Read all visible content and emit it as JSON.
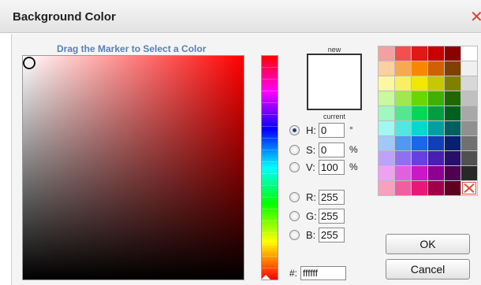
{
  "dialog": {
    "title": "Background Color",
    "close_symbol": "✕"
  },
  "picker": {
    "drag_hint": "Drag the Marker to Select a Color",
    "current_color": "#ffffff",
    "hue_color": "#ff0000"
  },
  "preview": {
    "new_label": "new",
    "current_label": "current",
    "new_color": "#ffffff"
  },
  "fields": {
    "h": {
      "label": "H:",
      "value": "0",
      "unit": "°",
      "selected": true
    },
    "s": {
      "label": "S:",
      "value": "0",
      "unit": "%"
    },
    "v": {
      "label": "V:",
      "value": "100",
      "unit": "%"
    },
    "r": {
      "label": "R:",
      "value": "255"
    },
    "g": {
      "label": "G:",
      "value": "255"
    },
    "b": {
      "label": "B:",
      "value": "255"
    },
    "hex": {
      "label": "#:",
      "value": "ffffff"
    }
  },
  "palette": [
    "#f4a0a0",
    "#f25050",
    "#e01818",
    "#c80000",
    "#8c0000",
    "#ffffff",
    "#fcd0a0",
    "#f8a850",
    "#f88800",
    "#d06000",
    "#804000",
    "#f0f0f0",
    "#fcf8a0",
    "#f8f060",
    "#f0e800",
    "#c8c800",
    "#808000",
    "#d8d8d8",
    "#c8f8a0",
    "#a0e850",
    "#68d800",
    "#40b000",
    "#206800",
    "#c0c0c0",
    "#a0f8c0",
    "#50e890",
    "#00d858",
    "#00a040",
    "#006020",
    "#a8a8a8",
    "#a0f8f0",
    "#50e8e0",
    "#00d8d0",
    "#00a0a0",
    "#006060",
    "#909090",
    "#a0c8f8",
    "#5098f0",
    "#1868e8",
    "#1040b8",
    "#082070",
    "#707070",
    "#c0a0f8",
    "#9070f0",
    "#6840e0",
    "#4820b0",
    "#281068",
    "#505050",
    "#f0a0f0",
    "#e060e0",
    "#c818c8",
    "#900090",
    "#500050",
    "#282828",
    "#f8a0c0",
    "#f060a0",
    "#e81878",
    "#a00048",
    "#600020",
    "none"
  ],
  "buttons": {
    "ok": "OK",
    "cancel": "Cancel"
  }
}
